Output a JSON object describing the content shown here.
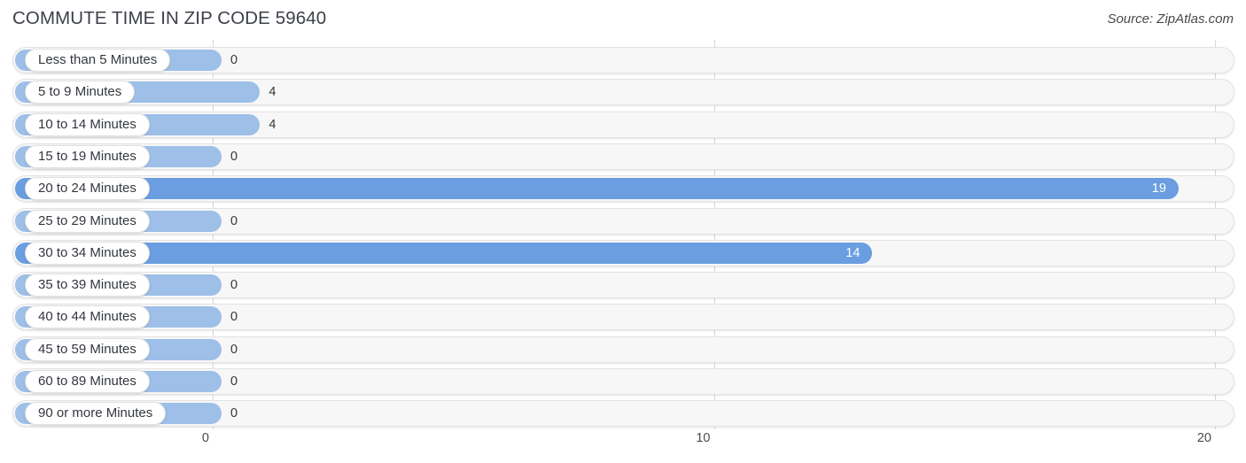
{
  "header": {
    "title": "COMMUTE TIME IN ZIP CODE 59640",
    "source": "Source: ZipAtlas.com"
  },
  "colors": {
    "bar_light": "#9dbfe8",
    "bar_dark": "#6a9ee0",
    "track": "#f7f7f7",
    "gridline": "#d8d8d8",
    "title_text": "#3c4049"
  },
  "chart_data": {
    "type": "bar",
    "orientation": "horizontal",
    "title": "COMMUTE TIME IN ZIP CODE 59640",
    "xlabel": "",
    "ylabel": "",
    "xlim": [
      0,
      20
    ],
    "grid": true,
    "legend": false,
    "xticks": [
      "0",
      "10",
      "20"
    ],
    "xtick_values": [
      0,
      10,
      20
    ],
    "categories": [
      "Less than 5 Minutes",
      "5 to 9 Minutes",
      "10 to 14 Minutes",
      "15 to 19 Minutes",
      "20 to 24 Minutes",
      "25 to 29 Minutes",
      "30 to 34 Minutes",
      "35 to 39 Minutes",
      "40 to 44 Minutes",
      "45 to 59 Minutes",
      "60 to 89 Minutes",
      "90 or more Minutes"
    ],
    "values": [
      0,
      4,
      4,
      0,
      19,
      0,
      14,
      0,
      0,
      0,
      0,
      0
    ],
    "value_labels": [
      "0",
      "4",
      "4",
      "0",
      "19",
      "0",
      "14",
      "0",
      "0",
      "0",
      "0",
      "0"
    ]
  }
}
